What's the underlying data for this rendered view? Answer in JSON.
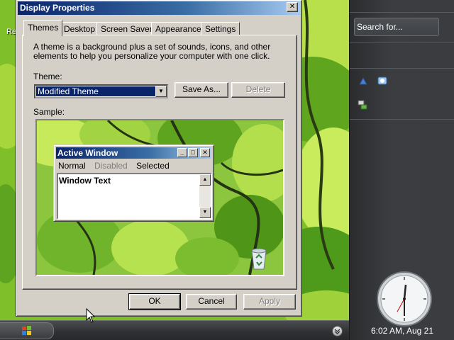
{
  "desktop": {
    "label_fragment": "Re"
  },
  "dialog": {
    "title": "Display Properties",
    "close_glyph": "✕",
    "tabs": [
      {
        "label": "Themes",
        "active": true
      },
      {
        "label": "Desktop",
        "active": false
      },
      {
        "label": "Screen Saver",
        "active": false
      },
      {
        "label": "Appearance",
        "active": false
      },
      {
        "label": "Settings",
        "active": false
      }
    ],
    "description": "A theme is a background plus a set of sounds, icons, and other elements to help you personalize your computer with one click.",
    "theme_label": "Theme:",
    "theme_value": "Modified Theme",
    "save_as_label": "Save As...",
    "delete_label": "Delete",
    "sample_label": "Sample:",
    "sample": {
      "window_title": "Active Window",
      "menu": [
        "Normal",
        "Disabled",
        "Selected"
      ],
      "window_text": "Window Text"
    },
    "ok_label": "OK",
    "cancel_label": "Cancel",
    "apply_label": "Apply"
  },
  "sidebar": {
    "search_placeholder": "Search for...",
    "clock_text": "6:02 AM, Aug 21"
  },
  "colors": {
    "title_active": "#0a246a",
    "dialog_face": "#d4d0c8",
    "selection": "#0a246a",
    "sidebar_bg": "#3a3c3f"
  },
  "icons": [
    "start-flag-icon",
    "tray-chevron-icon",
    "close-icon",
    "minimize-icon",
    "maximize-icon",
    "dropdown-arrow-icon",
    "scroll-up-icon",
    "scroll-down-icon",
    "recycle-bin-icon",
    "gadget-icon",
    "network-icon",
    "clock-icon"
  ]
}
